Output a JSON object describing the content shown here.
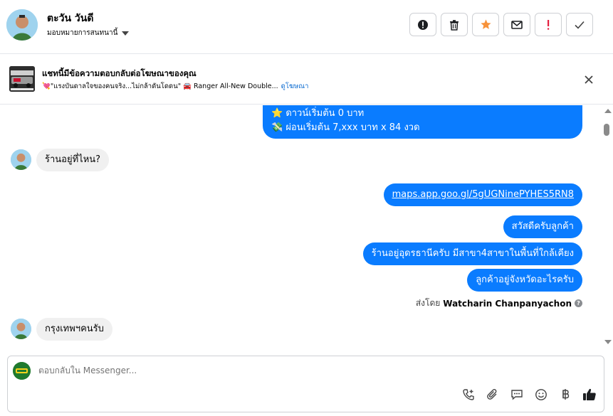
{
  "header": {
    "name": "ตะวัน วันดี",
    "assign_label": "มอบหมายการสนทนานี้",
    "actions": [
      "flag-alert-icon",
      "trash-icon",
      "star-icon",
      "mail-icon",
      "exclamation-icon",
      "check-icon"
    ]
  },
  "ad": {
    "title": "แชทนี้มีข้อความตอบกลับต่อโฆษณาของคุณ",
    "subtitle": "💘\"แรงบันดาลใจของคนจริง...ไม่กล้าดันโดดน\" 🚘 Ranger All-New Double...",
    "link": "ดูโฆษณา"
  },
  "messages": {
    "top_line1": "⭐ ดาวน์เริ่มต้น 0 บาท",
    "top_line2": "💸 ผ่อนเริ่มต้น 7,xxx บาท x 84 งวด",
    "m1": "ร้านอยู่ที่ไหน?",
    "m2": "maps.app.goo.gl/5gUGNinePYHES5RN8",
    "m3": "สวัสดีครับลูกค้า",
    "m4": "ร้านอยู่อุดรธานีครับ มีสาขา4สาขาในพื้นที่ใกล้เคียง",
    "m5": "ลูกค้าอยู่จังหวัดอะไรครับ",
    "sent_by_label": "ส่งโดย",
    "sent_by_name": "Watcharin Chanpanyachon",
    "m6": "กรุงเทพฯคนรับ"
  },
  "composer": {
    "placeholder": "ตอบกลับใน Messenger..."
  },
  "colors": {
    "accent": "#0a7cff",
    "star": "#f7923a",
    "alert": "#e41e3f"
  }
}
